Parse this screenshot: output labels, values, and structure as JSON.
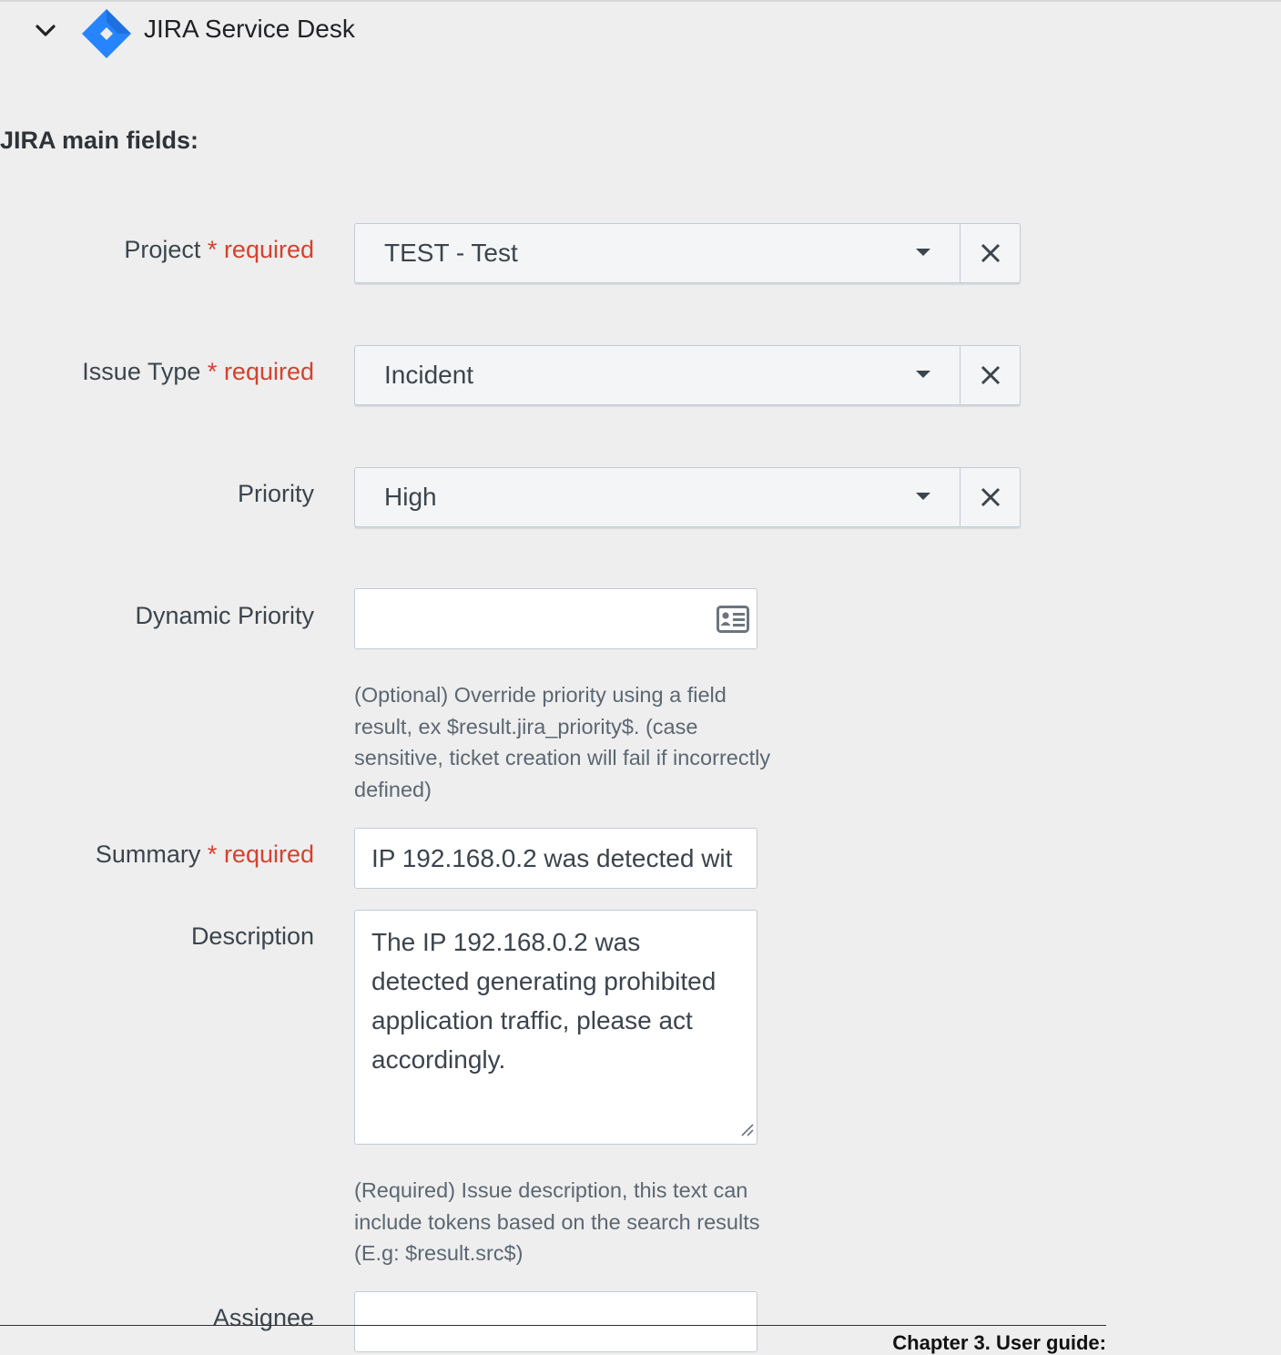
{
  "section": {
    "title": "JIRA Service Desk"
  },
  "main_heading": "JIRA main fields:",
  "required_text": "required",
  "required_star": "*",
  "fields": {
    "project": {
      "label": "Project",
      "value": "TEST - Test"
    },
    "issue_type": {
      "label": "Issue Type",
      "value": "Incident"
    },
    "priority": {
      "label": "Priority",
      "value": "High"
    },
    "dynamic_priority": {
      "label": "Dynamic Priority",
      "value": "",
      "help": "(Optional) Override priority using a field result, ex $result.jira_priority$. (case sensitive, ticket creation will fail if incorrectly defined)"
    },
    "summary": {
      "label": "Summary",
      "value": "IP 192.168.0.2 was detected wit"
    },
    "description": {
      "label": "Description",
      "value": "The IP 192.168.0.2 was detected generating prohibited application traffic, please act accordingly.",
      "help": "(Required) Issue description, this text can include tokens based on the search results (E.g: $result.src$)"
    },
    "assignee": {
      "label": "Assignee",
      "value": ""
    }
  },
  "footer": {
    "text": "Chapter 3.  User guide:"
  },
  "colors": {
    "required": "#d6412d",
    "jira_blue_dark": "#2684ff",
    "jira_blue_light": "#0052cc",
    "background": "#eeeeee"
  },
  "icons": {
    "collapse": "chevron-down-icon",
    "logo": "jira-logo-icon",
    "clear": "close-icon",
    "token": "id-card-icon",
    "resize": "resize-handle-icon"
  }
}
